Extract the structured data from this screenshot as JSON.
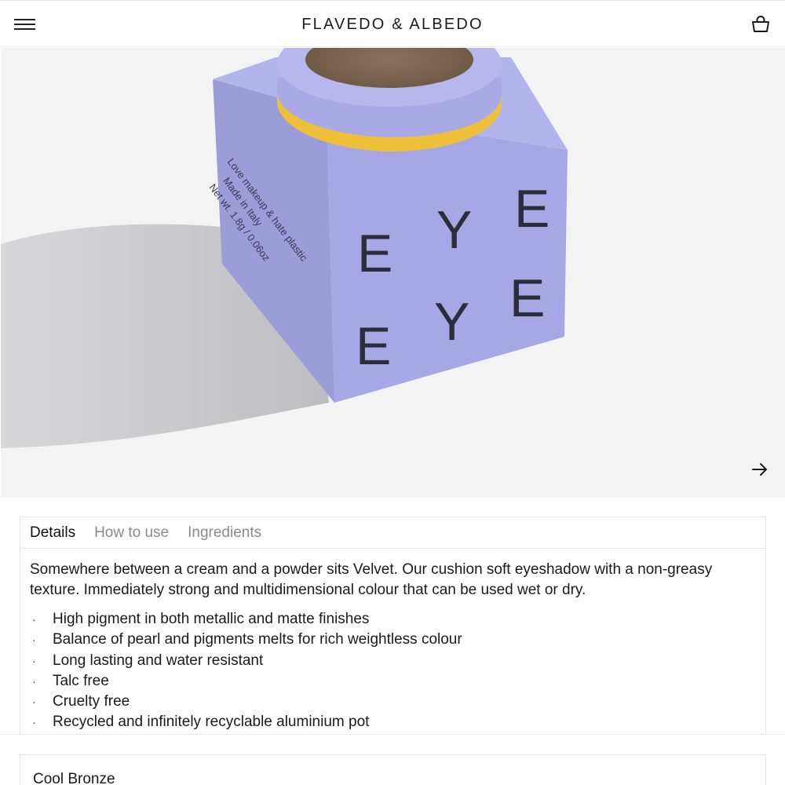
{
  "header": {
    "brand": "FLAVEDO & ALBEDO",
    "menu_icon": "hamburger-menu-icon",
    "cart_icon": "shopping-bag-icon"
  },
  "hero": {
    "box_front_letters": [
      "E",
      "Y",
      "E",
      "E",
      "Y",
      "E"
    ],
    "box_side_text": [
      "Love makeup & hate plastic",
      "Made in Italy",
      "Net wt. 1.8g / 0.06oz"
    ],
    "next_icon": "arrow-right-icon",
    "colors": {
      "box": "#a9a9e8",
      "box_side": "#9b9bd9",
      "pot_ring": "#f1c33c",
      "powder": "#7c6652",
      "background": "#f3f3f4"
    }
  },
  "tabs": {
    "items": [
      {
        "label": "Details",
        "active": true
      },
      {
        "label": "How to use",
        "active": false
      },
      {
        "label": "Ingredients",
        "active": false
      }
    ]
  },
  "details": {
    "description": "Somewhere between a cream and a powder sits Velvet. Our cushion soft eyeshadow with a non-greasy texture. Immediately strong and multidimensional colour that can be used wet or dry.",
    "bullet": "·",
    "features": [
      "High pigment in both metallic and matte finishes",
      "Balance of pearl and pigments melts for rich weightless colour",
      "Long lasting and water resistant",
      "Talc free",
      "Cruelty free",
      "Recycled and infinitely recyclable aluminium pot"
    ]
  },
  "variant": {
    "selected": "Cool Bronze"
  }
}
